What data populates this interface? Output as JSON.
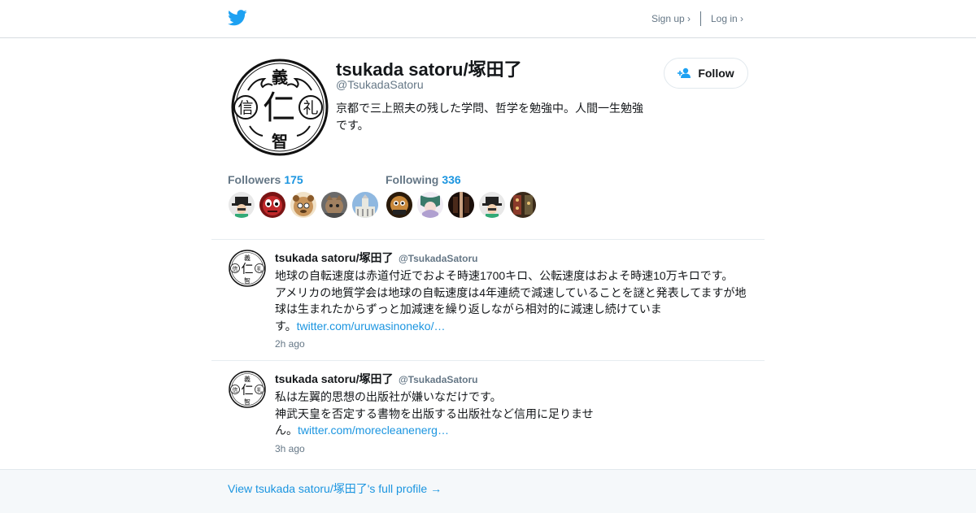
{
  "header": {
    "logo_icon": "twitter-bird-icon",
    "signup_label": "Sign up ›",
    "login_label": "Log in ›",
    "brand_color": "#1da1f2"
  },
  "profile": {
    "name": "tsukada satoru/塚田了",
    "handle": "@TsukadaSatoru",
    "bio_lines": [
      "京都で三上照夫の残した学問、哲学を勉強中。人間一生勉強",
      "です。"
    ],
    "avatar_glyphs": [
      "義",
      "信",
      "仁",
      "礼",
      "智"
    ],
    "follow_label": "Follow",
    "follow_icon": "add-person-icon"
  },
  "stats": {
    "followers_label": "Followers",
    "followers_count": "175",
    "following_label": "Following",
    "following_count": "336"
  },
  "tweets": [
    {
      "name": "tsukada satoru/塚田了",
      "handle": "@TsukadaSatoru",
      "lines": [
        "地球の自転速度は赤道付近でおよそ時速1700キロ、公転速度はおよそ時速10万キロです。",
        "アメリカの地質学会は地球の自転速度は4年連続で減速していることを謎と発表してますが地",
        "球は生まれたからずっと加減速を繰り返しながら相対的に減速し続けていま"
      ],
      "last_prefix": "す。",
      "link": "twitter.com/uruwasinoneko/…",
      "time": "2h ago"
    },
    {
      "name": "tsukada satoru/塚田了",
      "handle": "@TsukadaSatoru",
      "lines": [
        "私は左翼的思想の出版社が嫌いなだけです。",
        "神武天皇を否定する書物を出版する出版社など信用に足りませ"
      ],
      "last_prefix": "ん。",
      "link": "twitter.com/morecleanenerg…",
      "time": "3h ago"
    }
  ],
  "footer": {
    "link_label": "View tsukada satoru/塚田了's full profile →"
  },
  "colors": {
    "link": "#1b95e0",
    "secondary_text": "#657786",
    "footer_bg": "#f5f8fa"
  }
}
